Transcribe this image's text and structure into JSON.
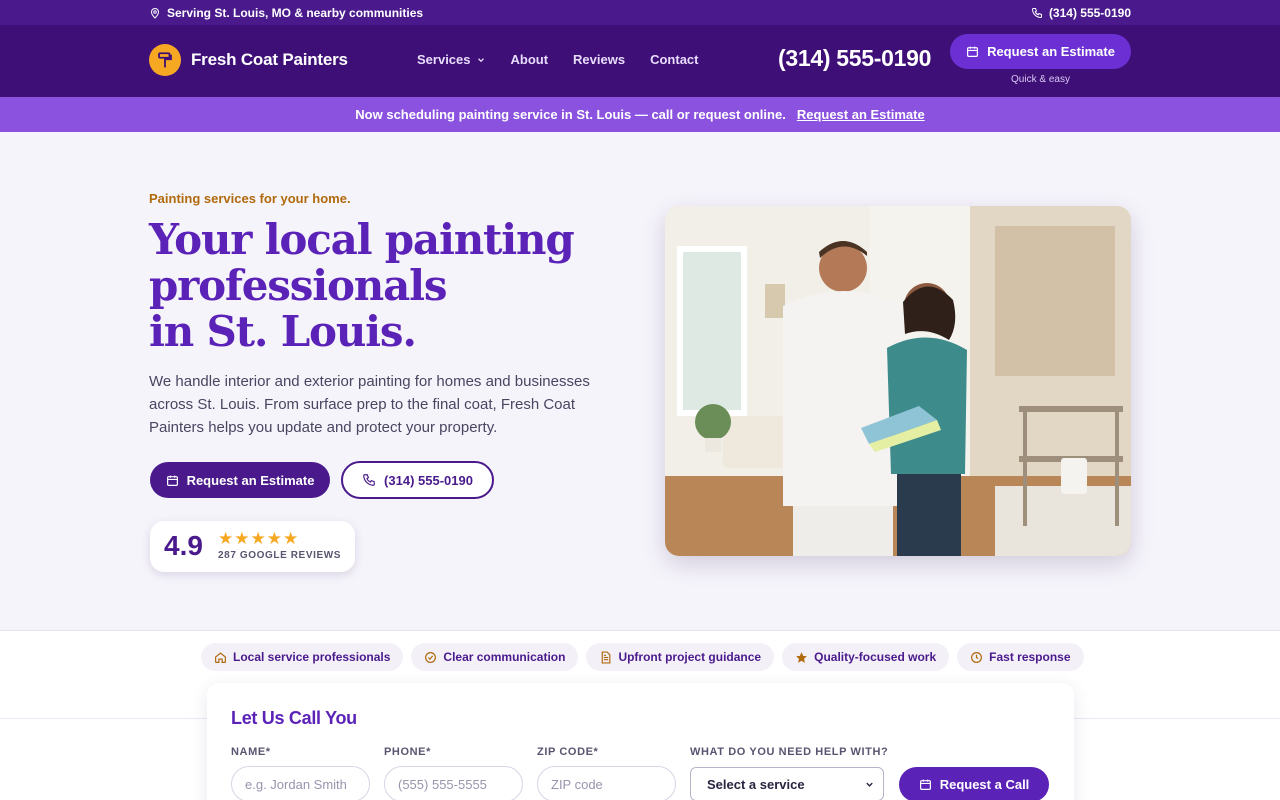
{
  "utility": {
    "location": "Serving St. Louis, MO & nearby communities",
    "phone": "(314) 555-0190"
  },
  "header": {
    "brand": "Fresh Coat Painters",
    "nav": [
      "Services",
      "About",
      "Reviews",
      "Contact"
    ],
    "phone": "(314) 555-0190",
    "cta": "Request an Estimate",
    "cta_sub": "Quick & easy"
  },
  "announcement": {
    "text": "Now scheduling painting service in St. Louis — call or request online.",
    "link": "Request an Estimate"
  },
  "hero": {
    "eyebrow": "Painting services for your home.",
    "title_line1": "Your local painting",
    "title_line2": "professionals",
    "title_line3": "in St. Louis.",
    "lede": "We handle interior and exterior painting for homes and businesses across St. Louis. From surface prep to the final coat, Fresh Coat Painters helps you update and protect your property.",
    "primary_cta": "Request an Estimate",
    "phone_cta": "(314) 555-0190",
    "rating": {
      "score": "4.9",
      "stars": "★★★★★",
      "reviews": "287 GOOGLE REVIEWS"
    }
  },
  "trust_chips": [
    {
      "label": "Local service professionals",
      "icon": "home-icon"
    },
    {
      "label": "Clear communication",
      "icon": "check-circle-icon"
    },
    {
      "label": "Upfront project guidance",
      "icon": "document-icon"
    },
    {
      "label": "Quality-focused work",
      "icon": "star-icon"
    },
    {
      "label": "Fast response",
      "icon": "clock-icon"
    }
  ],
  "callback_form": {
    "title": "Let Us Call You",
    "name_label": "NAME*",
    "name_placeholder": "e.g. Jordan Smith",
    "phone_label": "PHONE*",
    "phone_placeholder": "(555) 555-5555",
    "zip_label": "ZIP CODE*",
    "zip_placeholder": "ZIP code",
    "help_label": "WHAT DO YOU NEED HELP WITH?",
    "help_selected": "Select a service",
    "submit": "Request a Call"
  },
  "colors": {
    "brand_dark": "#3f0f78",
    "brand_primary": "#4a1a8c",
    "accent_purple": "#6b2fd4",
    "announcement": "#8a52df",
    "heading": "#5b22b8",
    "accent_orange": "#f7a823",
    "eyebrow": "#b06a0c"
  }
}
